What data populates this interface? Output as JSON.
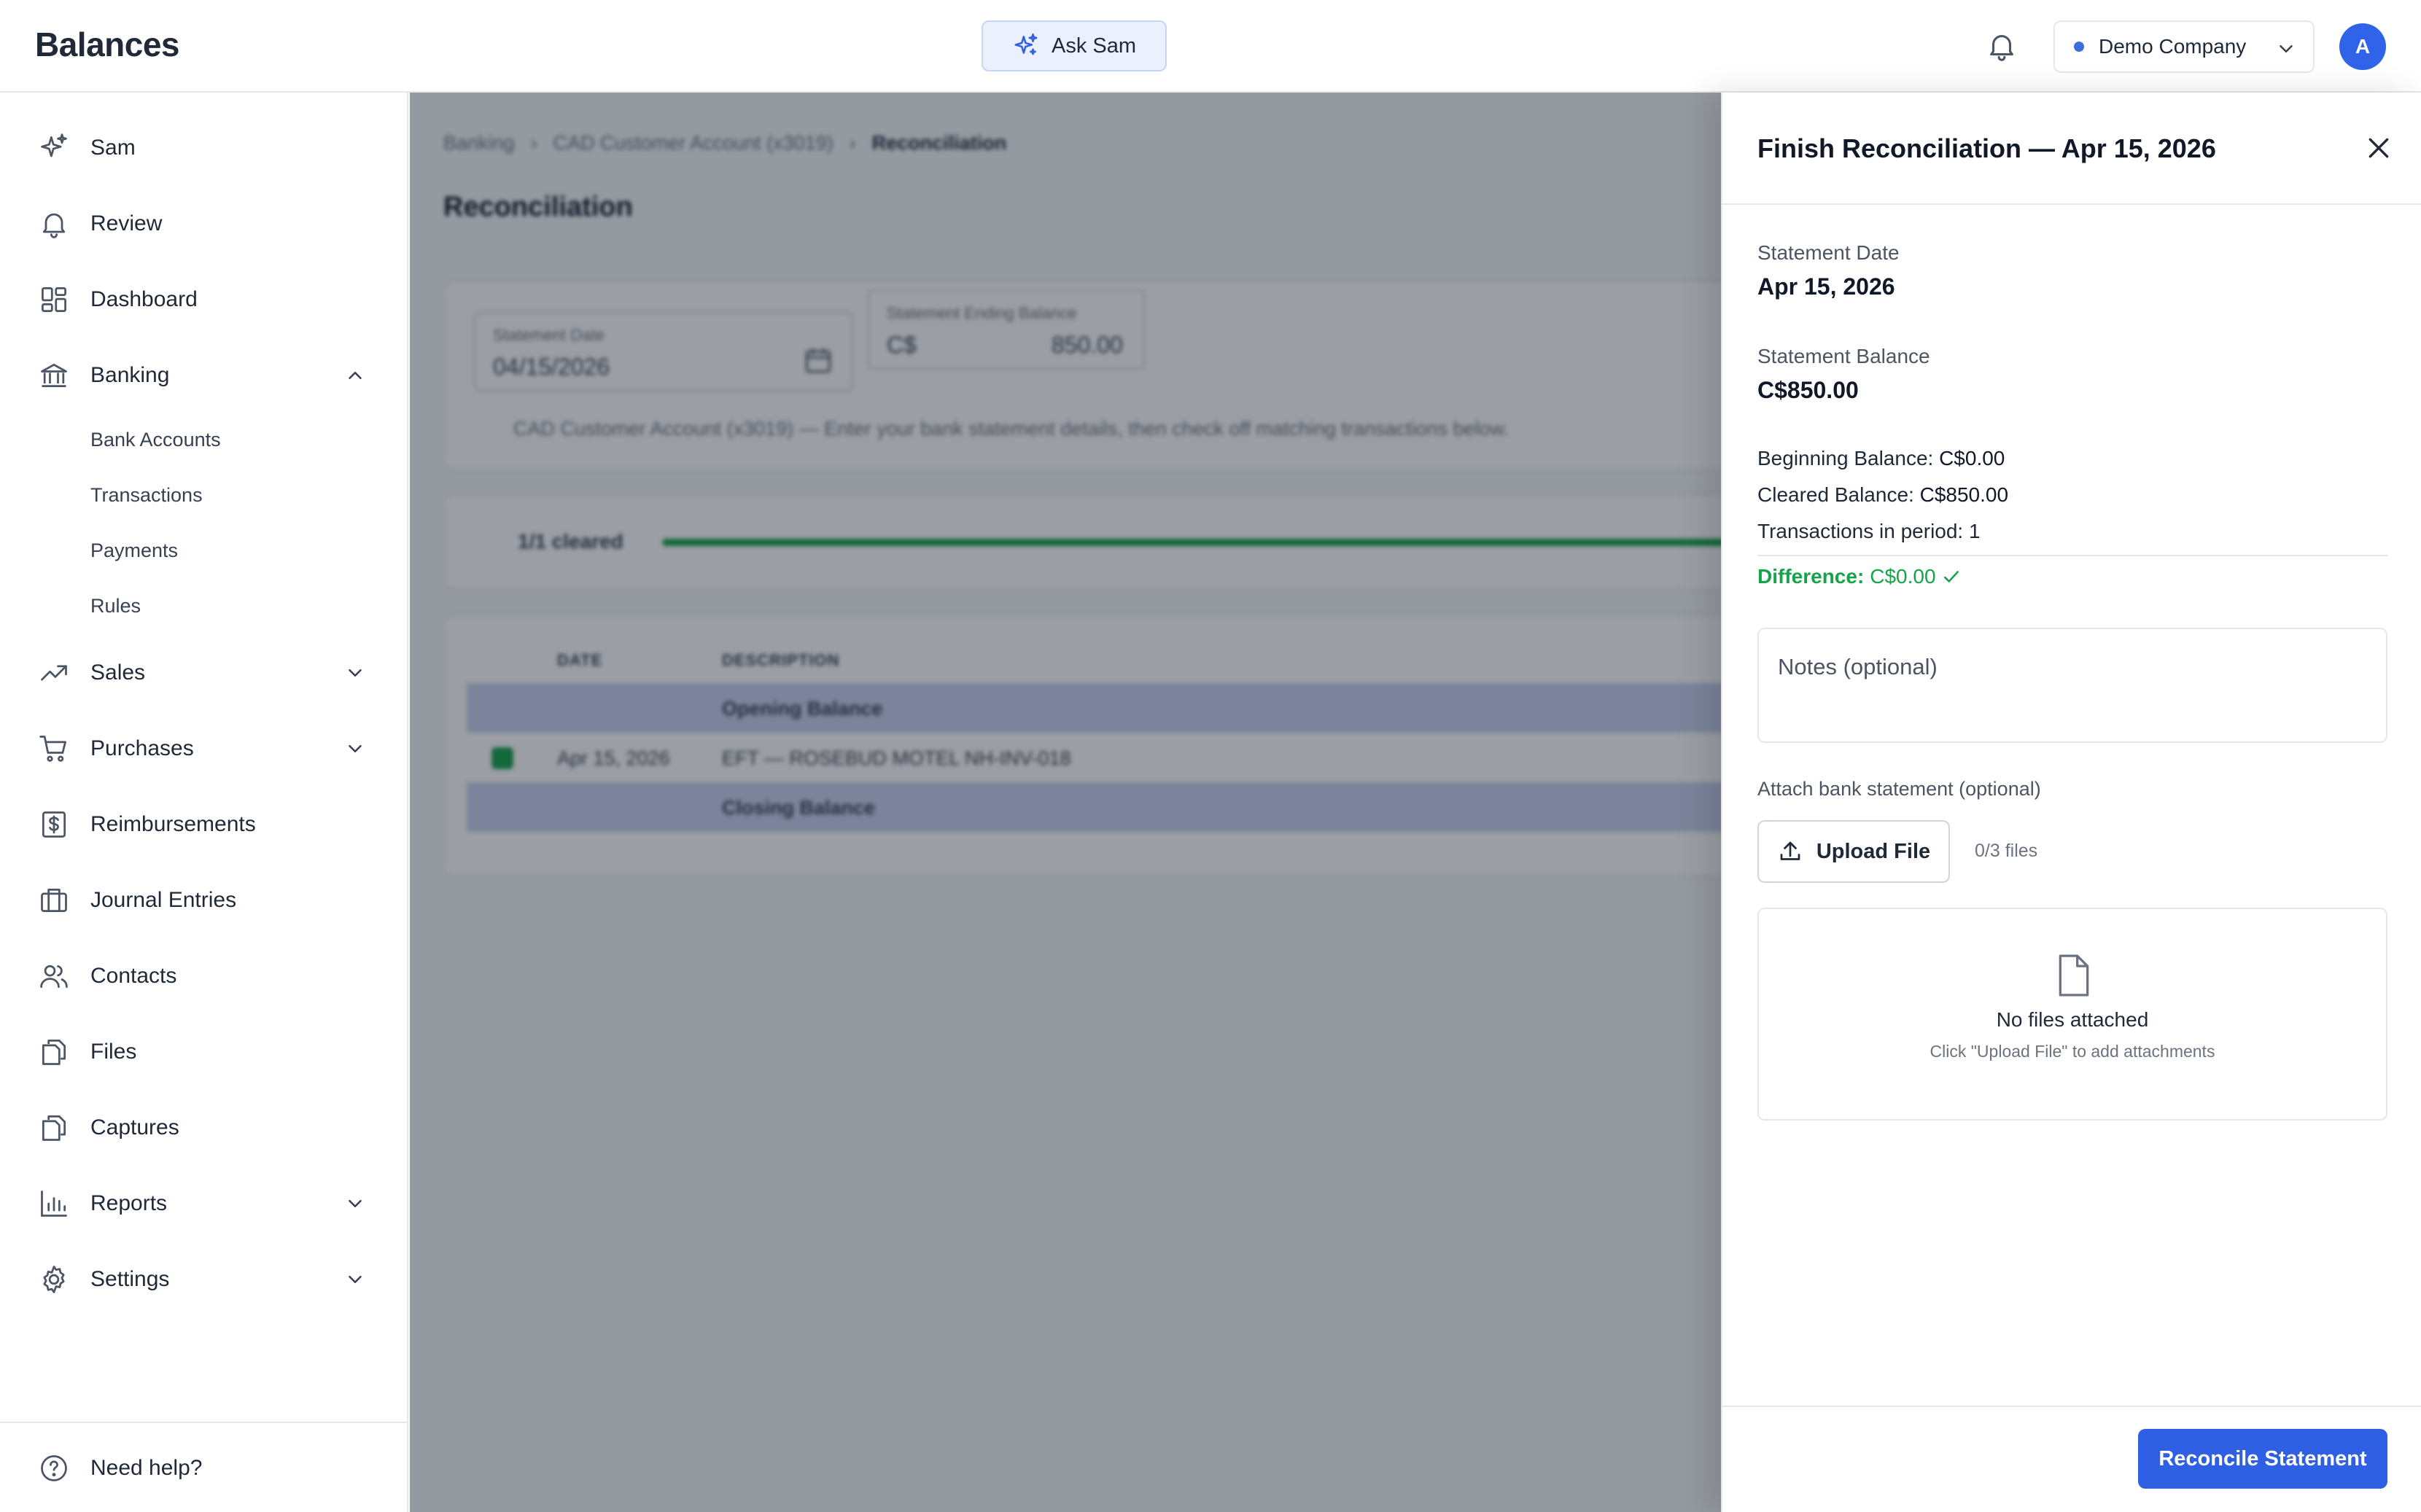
{
  "app": {
    "brand": "Balances"
  },
  "topbar": {
    "ask_label": "Ask Sam",
    "company_name": "Demo Company",
    "avatar_initial": "A"
  },
  "sidebar": {
    "items": [
      {
        "label": "Sam",
        "icon": "sparkles-icon"
      },
      {
        "label": "Review",
        "icon": "bell-icon"
      },
      {
        "label": "Dashboard",
        "icon": "dashboard-icon"
      },
      {
        "label": "Banking",
        "icon": "bank-icon",
        "expanded": true
      },
      {
        "label": "Sales",
        "icon": "trending-up-icon"
      },
      {
        "label": "Purchases",
        "icon": "cart-icon"
      },
      {
        "label": "Reimbursements",
        "icon": "receipt-dollar-icon"
      },
      {
        "label": "Journal Entries",
        "icon": "briefcase-icon"
      },
      {
        "label": "Contacts",
        "icon": "users-icon"
      },
      {
        "label": "Files",
        "icon": "files-icon"
      },
      {
        "label": "Captures",
        "icon": "files-icon"
      },
      {
        "label": "Reports",
        "icon": "bar-chart-icon"
      },
      {
        "label": "Settings",
        "icon": "gear-icon"
      }
    ],
    "banking_sub": [
      "Bank Accounts",
      "Transactions",
      "Payments",
      "Rules"
    ],
    "help_label": "Need help?"
  },
  "main": {
    "breadcrumbs": [
      "Banking",
      "CAD Customer Account (x3019)",
      "Reconciliation"
    ],
    "title": "Reconciliation",
    "statement_date_label": "Statement Date",
    "statement_date_value": "04/15/2026",
    "ending_balance_label": "Statement Ending Balance",
    "ending_balance_currency": "C$",
    "ending_balance_value": "850.00",
    "hint": "CAD Customer Account (x3019) — Enter your bank statement details, then check off matching transactions below.",
    "cleared_text": "1/1 cleared",
    "cleared_progress": 1.0,
    "table_headers": [
      "DATE",
      "DESCRIPTION"
    ],
    "rows": [
      {
        "date": "",
        "description": "Opening Balance"
      },
      {
        "date": "Apr 15, 2026",
        "description": "EFT — ROSEBUD MOTEL NH-INV-018"
      },
      {
        "date": "",
        "description": "Closing Balance"
      }
    ]
  },
  "panel": {
    "title": "Finish Reconciliation — Apr 15, 2026",
    "statement_date_label": "Statement Date",
    "statement_date_value": "Apr 15, 2026",
    "statement_balance_label": "Statement Balance",
    "statement_balance_value": "C$850.00",
    "beginning_label": "Beginning Balance:",
    "beginning_value": "C$0.00",
    "cleared_label": "Cleared Balance:",
    "cleared_value": "C$850.00",
    "txn_label": "Transactions in period:",
    "txn_value": "1",
    "difference_label": "Difference:",
    "difference_value": "C$0.00",
    "notes_placeholder": "Notes (optional)",
    "attach_label": "Attach bank statement (optional)",
    "upload_label": "Upload File",
    "file_count": "0/3 files",
    "empty_title": "No files attached",
    "empty_hint": "Click \"Upload File\" to add attachments",
    "submit_label": "Reconcile Statement"
  },
  "colors": {
    "accent": "#2f5fe3",
    "success": "#16a34a"
  }
}
